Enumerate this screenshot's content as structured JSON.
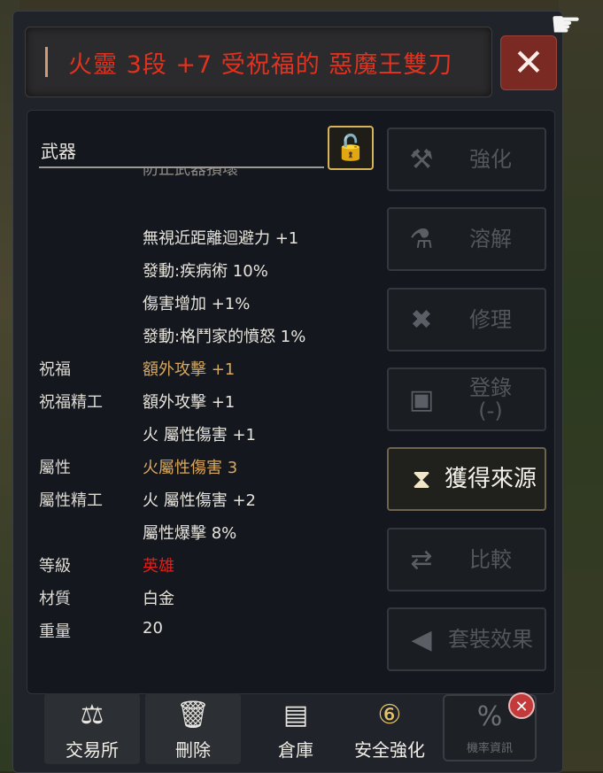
{
  "title": "火靈 3段 +7 受祝福的 惡魔王雙刀",
  "close_icon": "close-icon",
  "section_label": "武器",
  "stats": [
    {
      "label": "",
      "value": "防止武器損壞",
      "style": "dim"
    },
    {
      "label": "",
      "value": "無視近距離迴避力 +1",
      "style": "white"
    },
    {
      "label": "",
      "value": "發動:疾病術 10%",
      "style": "white"
    },
    {
      "label": "",
      "value": "傷害增加 +1%",
      "style": "white"
    },
    {
      "label": "",
      "value": "發動:格鬥家的憤怒 1%",
      "style": "white"
    },
    {
      "label": "祝福",
      "value": "額外攻擊 +1",
      "style": "gold"
    },
    {
      "label": "祝福精工",
      "value": "額外攻擊 +1",
      "style": "white"
    },
    {
      "label": "",
      "value": "火 屬性傷害 +1",
      "style": "white"
    },
    {
      "label": "屬性",
      "value": "火屬性傷害 3",
      "style": "gold"
    },
    {
      "label": "屬性精工",
      "value": "火 屬性傷害 +2",
      "style": "white"
    },
    {
      "label": "",
      "value": "屬性爆擊 8%",
      "style": "white"
    },
    {
      "label": "等級",
      "value": "英雄",
      "style": "red"
    },
    {
      "label": "材質",
      "value": "白金",
      "style": "white"
    },
    {
      "label": "重量",
      "value": "20",
      "style": "white"
    }
  ],
  "side_buttons": [
    {
      "label": "強化",
      "icon": "anvil-icon",
      "glyph": "⚒",
      "active": false
    },
    {
      "label": "溶解",
      "icon": "potion-icon",
      "glyph": "⚗",
      "active": false
    },
    {
      "label": "修理",
      "icon": "repair-tools-icon",
      "glyph": "✖",
      "active": false
    },
    {
      "label": "登錄\n(-)",
      "icon": "book-icon",
      "glyph": "▣",
      "active": false
    },
    {
      "label": "獲得來源",
      "icon": "source-icon",
      "glyph": "⧗",
      "active": true
    },
    {
      "label": "比較",
      "icon": "swap-icon",
      "glyph": "⇄",
      "active": false
    },
    {
      "label": "套裝效果",
      "icon": "arrow-left-icon",
      "glyph": "◀",
      "active": false
    }
  ],
  "bottom_buttons": [
    {
      "label": "交易所",
      "icon": "scales-icon",
      "glyph": "⚖"
    },
    {
      "label": "刪除",
      "icon": "trash-icon",
      "glyph": "🗑"
    },
    {
      "label": "倉庫",
      "icon": "chest-icon",
      "glyph": "▤"
    },
    {
      "label": "安全強化",
      "icon": "safe-enchant-icon",
      "glyph": "⑥"
    }
  ],
  "rate_button": {
    "label": "機率資訊",
    "icon": "percent-icon",
    "glyph": "%"
  }
}
